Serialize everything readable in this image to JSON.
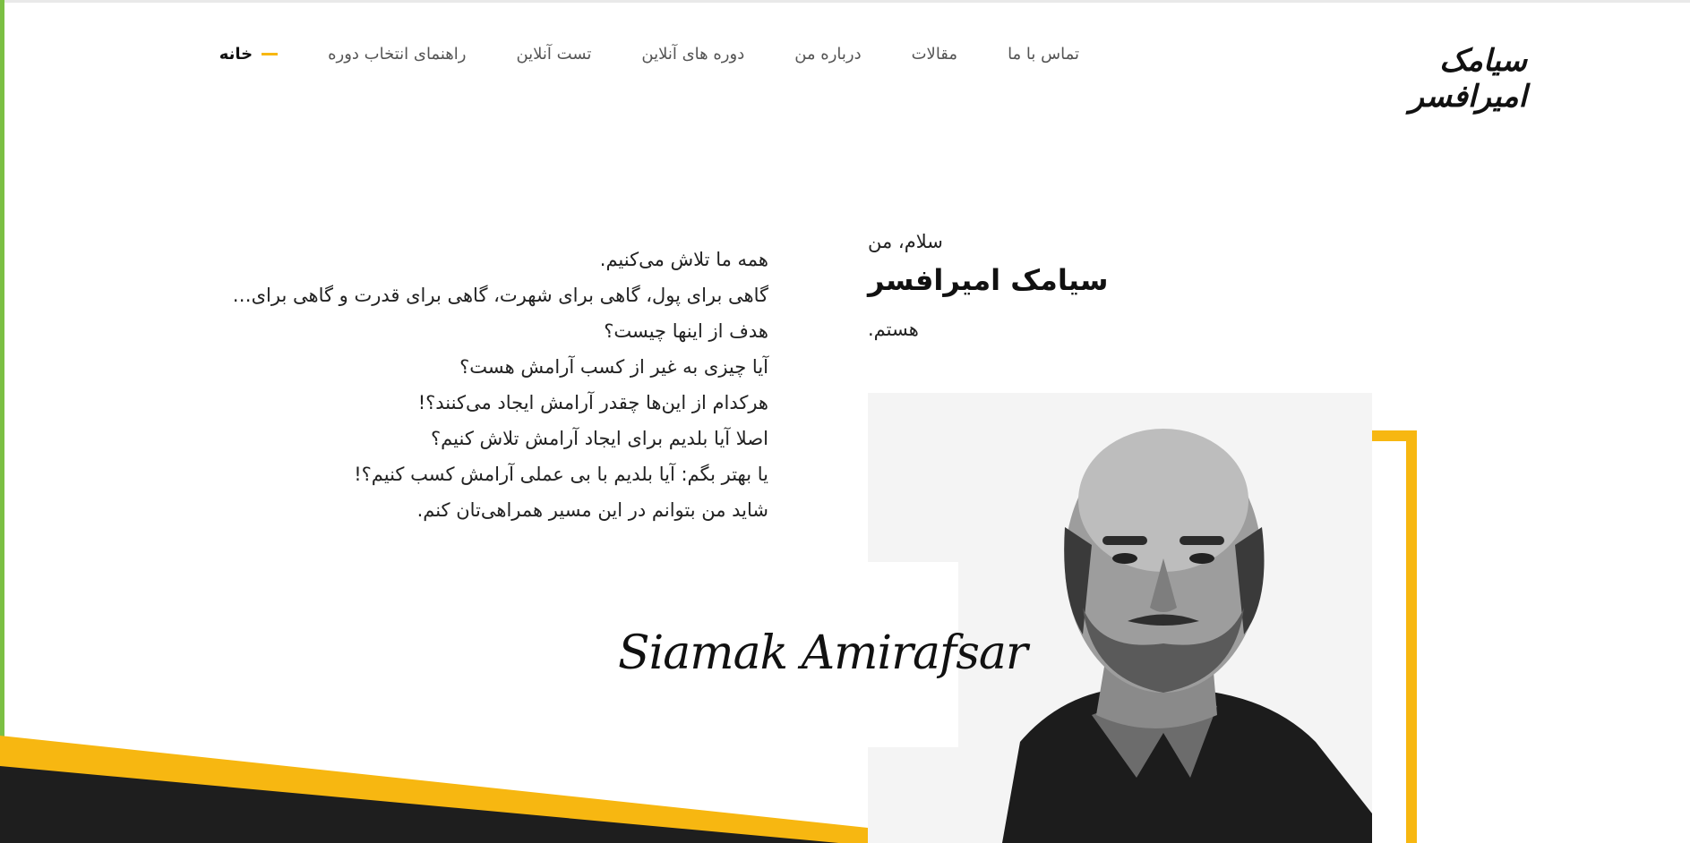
{
  "header": {
    "logo_text": "سیامک امیرافسر",
    "nav": [
      {
        "label": "خانه",
        "active": true
      },
      {
        "label": "راهنمای انتخاب دوره",
        "active": false
      },
      {
        "label": "تست آنلاین",
        "active": false
      },
      {
        "label": "دوره های آنلاین",
        "active": false
      },
      {
        "label": "درباره من",
        "active": false
      },
      {
        "label": "مقالات",
        "active": false
      },
      {
        "label": "تماس با ما",
        "active": false
      }
    ]
  },
  "intro": {
    "greeting": "سلام، من",
    "name": "سیامک امیرافسر",
    "suffix": "هستم."
  },
  "paragraph": [
    "همه ما تلاش می‌کنیم.",
    "گاهی برای پول، گاهی برای شهرت، گاهی برای قدرت و گاهی برای…",
    "هدف از اینها چیست؟",
    "آیا چیزی به غیر از کسب آرامش هست؟",
    "هرکدام از این‌ها چقدر آرامش ایجاد می‌کنند؟!",
    "اصلا آیا بلدیم برای ایجاد آرامش تلاش کنیم؟",
    "یا بهتر بگم: آیا بلدیم با بی عملی آرامش کسب کنیم؟!",
    "شاید من بتوانم در این مسیر همراهی‌تان کنم."
  ],
  "signature": "Siamak Amirafsar",
  "colors": {
    "accent": "#f7b711",
    "dark": "#1e1e1e",
    "left_bar": "#7bc043"
  }
}
